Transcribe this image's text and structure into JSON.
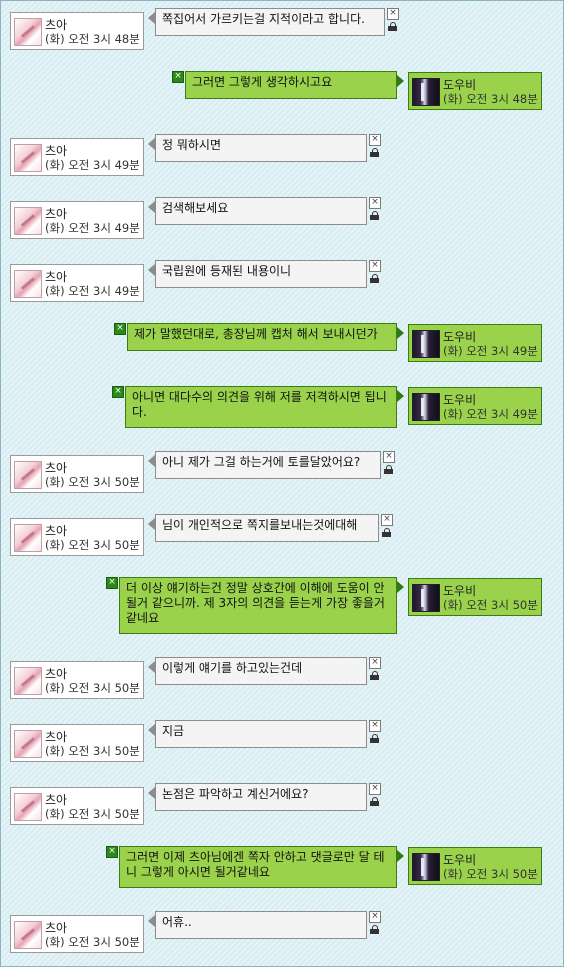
{
  "users": {
    "gray": {
      "name": "츠아"
    },
    "green": {
      "name": "도우비"
    }
  },
  "controls": {
    "close": "×"
  },
  "messages": [
    {
      "side": "left",
      "name": "츠아",
      "time": "(화) 오전 3시 48분",
      "text": "쪽집어서 가르키는걸 지적이라고 합니다."
    },
    {
      "side": "right",
      "name": "도우비",
      "time": "(화) 오전 3시 48분",
      "text": "그러면 그렇게 생각하시고요"
    },
    {
      "side": "left",
      "name": "츠아",
      "time": "(화) 오전 3시 49분",
      "text": "정 뭐하시면"
    },
    {
      "side": "left",
      "name": "츠아",
      "time": "(화) 오전 3시 49분",
      "text": "검색해보세요"
    },
    {
      "side": "left",
      "name": "츠아",
      "time": "(화) 오전 3시 49분",
      "text": "국립원에 등재된 내용이니"
    },
    {
      "side": "right",
      "name": "도우비",
      "time": "(화) 오전 3시 49분",
      "text": "제가 말했던대로, 총장님께 캡처 해서 보내시던가"
    },
    {
      "side": "right",
      "name": "도우비",
      "time": "(화) 오전 3시 49분",
      "text": "아니면 대다수의 의견을 위해 저를 저격하시면 됩니다."
    },
    {
      "side": "left",
      "name": "츠아",
      "time": "(화) 오전 3시 50분",
      "text": "아니 제가 그걸 하는거에 토를달았어요?"
    },
    {
      "side": "left",
      "name": "츠아",
      "time": "(화) 오전 3시 50분",
      "text": "님이 개인적으로 쪽지를보내는것에대해"
    },
    {
      "side": "right",
      "name": "도우비",
      "time": "(화) 오전 3시 50분",
      "text": "더 이상 얘기하는건 정말 상호간에 이해에 도움이 안될거 같으니까. 제 3자의 의견을 듣는게 가장 좋을거같네요"
    },
    {
      "side": "left",
      "name": "츠아",
      "time": "(화) 오전 3시 50분",
      "text": "이렇게 얘기를 하고있는건데"
    },
    {
      "side": "left",
      "name": "츠아",
      "time": "(화) 오전 3시 50분",
      "text": "지금"
    },
    {
      "side": "left",
      "name": "츠아",
      "time": "(화) 오전 3시 50분",
      "text": "논점은 파악하고 계신거에요?"
    },
    {
      "side": "right",
      "name": "도우비",
      "time": "(화) 오전 3시 50분",
      "text": "그러면 이제 츠아님에겐 쪽자 안하고 댓글로만 달 테니 그렇게 아시면 될거같네요"
    },
    {
      "side": "left",
      "name": "츠아",
      "time": "(화) 오전 3시 50분",
      "text": "어휴.."
    }
  ]
}
